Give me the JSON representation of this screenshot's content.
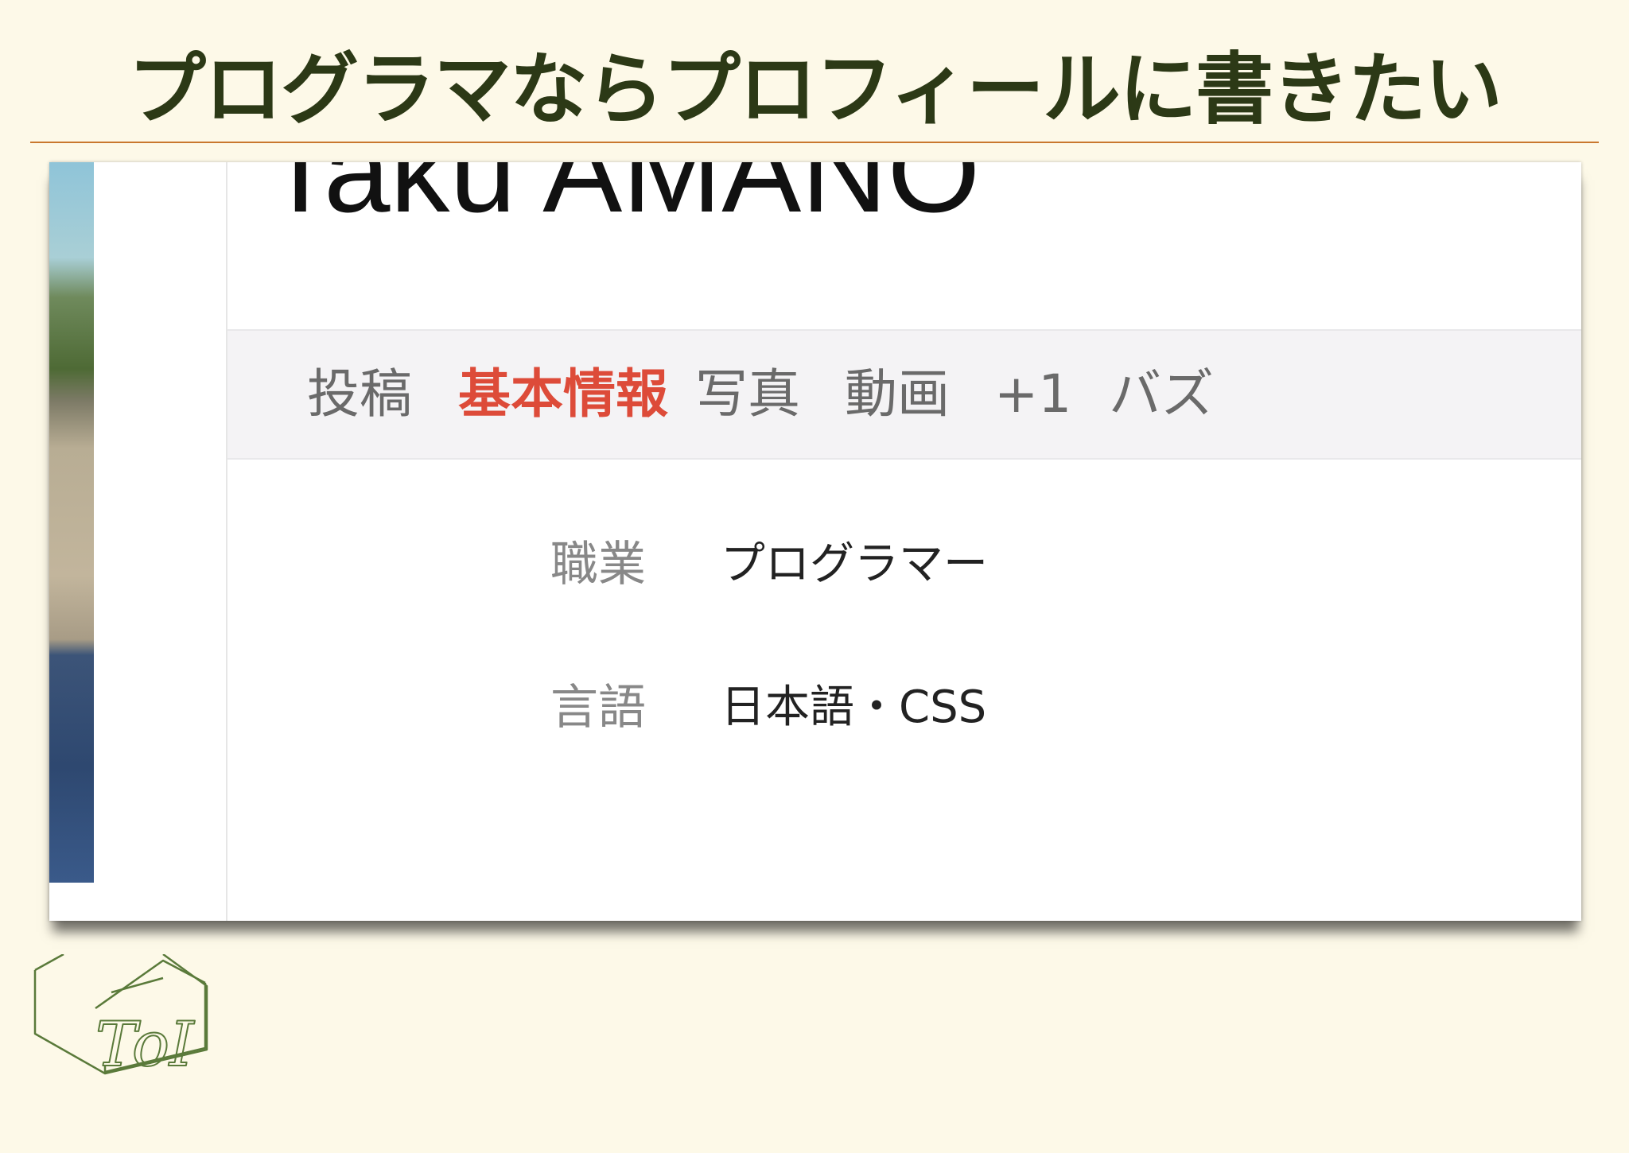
{
  "slide": {
    "title": "プログラマならプロフィールに書きたい"
  },
  "profile": {
    "name": "Taku AMANO",
    "tabs": [
      {
        "label": "投稿",
        "active": false
      },
      {
        "label": "基本情報",
        "active": true
      },
      {
        "label": "写真",
        "active": false
      },
      {
        "label": "動画",
        "active": false
      },
      {
        "label": "+1",
        "active": false
      },
      {
        "label": "バズ",
        "active": false
      }
    ],
    "info": [
      {
        "label": "職業",
        "value": "プログラマー"
      },
      {
        "label": "言語",
        "value": "日本語・CSS"
      }
    ]
  },
  "logo": {
    "text": "ToI",
    "icon": "house-cube-logo"
  },
  "colors": {
    "background": "#fdf9e8",
    "title": "#2c3916",
    "rule": "#c9782e",
    "active_tab": "#dd4b39",
    "logo": "#5a7a3a"
  }
}
